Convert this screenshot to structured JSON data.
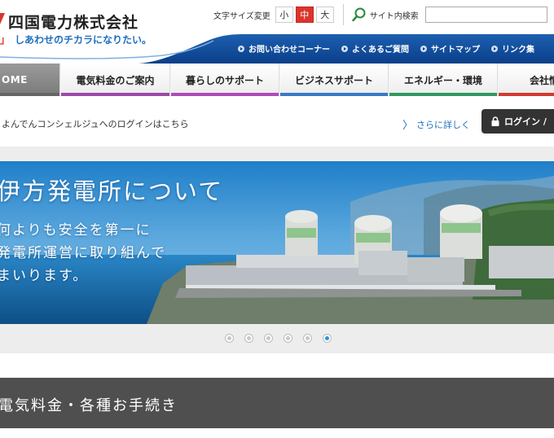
{
  "logo": {
    "name": "四国電力株式会社",
    "tagline": "しあわせのチカラになりたい。"
  },
  "topbar": {
    "font_size_label": "文字サイズ変更",
    "font_sizes": [
      "小",
      "中",
      "大"
    ],
    "active_font_size": "中",
    "search_label": "サイト内検索",
    "search_value": ""
  },
  "utility_links": [
    "お問い合わせコーナー",
    "よくあるご質問",
    "サイトマップ",
    "リンク集"
  ],
  "nav": {
    "home": "OME",
    "items": [
      "電気料金のご案内",
      "暮らしのサポート",
      "ビジネスサポート",
      "エネルギー・環境",
      "会社情"
    ]
  },
  "login": {
    "concierge_text": "よんでんコンシェルジュへのログインはこちら",
    "more_link": "さらに詳しく",
    "button_label": "ログイン /"
  },
  "banner": {
    "title": "伊方発電所について",
    "lines": [
      "何よりも安全を第一に",
      "発電所運営に取り組んで",
      "まいります。"
    ],
    "slide_count": 6,
    "active_slide": 6
  },
  "section": {
    "title": "電気料金・各種お手続き"
  },
  "colors": {
    "brand_blue": "#0a3f8a",
    "nav_bar_1": "#9b4aa8",
    "nav_bar_2": "#a44ab0",
    "nav_bar_3": "#3a78c8",
    "nav_bar_4": "#2f9a62",
    "nav_bar_5": "#d43a2e",
    "active_font": "#d9362b"
  }
}
